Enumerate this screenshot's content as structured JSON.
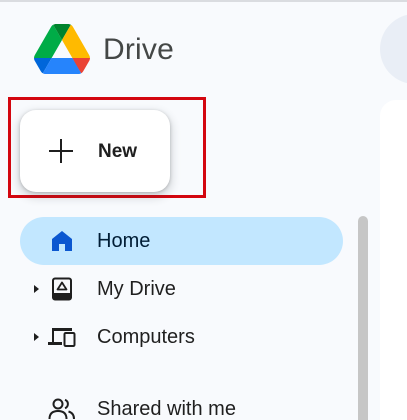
{
  "app": {
    "product_name": "Drive"
  },
  "new_button": {
    "label": "New"
  },
  "sidebar": {
    "items": [
      {
        "label": "Home",
        "icon": "home-icon",
        "active": true
      },
      {
        "label": "My Drive",
        "icon": "my-drive-icon",
        "expandable": true
      },
      {
        "label": "Computers",
        "icon": "computers-icon",
        "expandable": true
      },
      {
        "label": "Shared with me",
        "icon": "shared-with-me-icon"
      }
    ]
  },
  "colors": {
    "active_nav_background": "#c2e7ff",
    "highlight_frame": "#d3060f",
    "page_background": "#f8fafd"
  }
}
